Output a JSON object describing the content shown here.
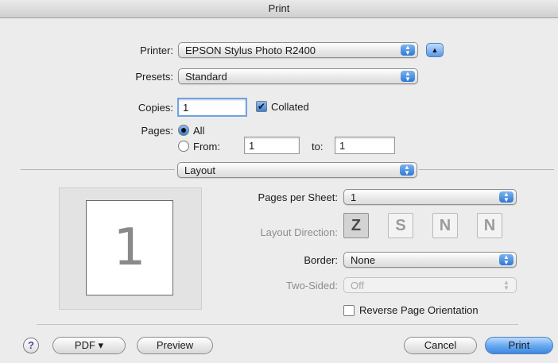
{
  "window": {
    "title": "Print"
  },
  "printer": {
    "label": "Printer:",
    "value": "EPSON Stylus Photo R2400"
  },
  "presets": {
    "label": "Presets:",
    "value": "Standard"
  },
  "copies": {
    "label": "Copies:",
    "value": "1",
    "collated_label": "Collated",
    "collated_checked": true
  },
  "pages": {
    "label": "Pages:",
    "all_label": "All",
    "from_label": "From:",
    "from_value": "1",
    "to_label": "to:",
    "to_value": "1"
  },
  "section": {
    "value": "Layout"
  },
  "preview": {
    "page_number": "1"
  },
  "layout": {
    "pages_per_sheet_label": "Pages per Sheet:",
    "pages_per_sheet_value": "1",
    "direction_label": "Layout Direction:",
    "direction_icons": [
      "Z",
      "S",
      "N",
      "N"
    ],
    "border_label": "Border:",
    "border_value": "None",
    "two_sided_label": "Two-Sided:",
    "two_sided_value": "Off",
    "reverse_label": "Reverse Page Orientation"
  },
  "buttons": {
    "help": "?",
    "pdf": "PDF ▾",
    "preview": "Preview",
    "cancel": "Cancel",
    "print": "Print"
  },
  "icons": {
    "popup_arrows": "up-down-arrows-icon",
    "disclosure": "disclosure-triangle-icon",
    "check": "✔"
  },
  "colors": {
    "accent": "#3c87e0",
    "window_bg": "#ececec"
  }
}
